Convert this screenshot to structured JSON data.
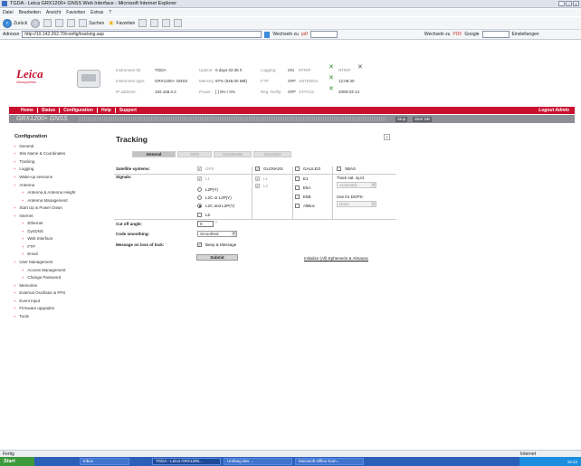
{
  "window": {
    "title": "TGDA - Leica GRX1200+ GNSS Web Interface - Microsoft Internet Explorer",
    "controls": [
      "_",
      "□",
      "X"
    ]
  },
  "menu": [
    "Datei",
    "Bearbeiten",
    "Ansicht",
    "Favoriten",
    "Extras",
    "?"
  ],
  "toolbar": {
    "back": "Zurück",
    "search": "Suchen",
    "favorites": "Favoriten",
    "links": "Links"
  },
  "addressbar": {
    "label": "Adresse",
    "url": "http://10.142.262.70/config/tracking.asp",
    "wechseln": "Wechseln zu",
    "pdf": "pdf",
    "google": "Google",
    "settings": "Einstellungen",
    "pdf2": "PDF"
  },
  "header": {
    "logo_text": "Leica",
    "logo_sub": "Geosystems",
    "info": [
      {
        "label": "Instrument ID:",
        "value": "TGDA",
        "label2": "Uptime:",
        "value2": "0 days 02:35 h",
        "label3": "Logging:",
        "value3": "ON",
        "label4": "NTRIP"
      },
      {
        "label": "Instrument type:",
        "value": "GRX1200+ GNSS",
        "label2": "Memory:",
        "value2": "97% (948.00 MB)",
        "label3": "FTP:",
        "value3": "OFF",
        "label4": "ANTENNA"
      },
      {
        "label": "IP address:",
        "value": "192.168.0.2",
        "label2": "Power:",
        "value2": "[ ] 0% / 0%",
        "label3": "Reg. Notify:",
        "value3": "OFF",
        "label4": "STATUS",
        "time": "12:06:30",
        "date": "2009-03-13"
      }
    ]
  },
  "nav": {
    "items": [
      "Home",
      "Status",
      "Configuration",
      "Help",
      "Support"
    ],
    "admin": "Logout Admin"
  },
  "subbar": {
    "model": "GRX1200+ GNSS",
    "btn1": "Stop",
    "btn2": "Start DB"
  },
  "sidebar": {
    "title": "Configuration",
    "items": [
      {
        "label": "General",
        "indent": 0
      },
      {
        "label": "Site Name & Coordinates",
        "indent": 0
      },
      {
        "label": "Tracking",
        "indent": 0
      },
      {
        "label": "Logging",
        "indent": 0
      },
      {
        "label": "Wake-up sessions",
        "indent": 0
      },
      {
        "label": "Antenna",
        "indent": 0
      },
      {
        "label": "Antenna & Antenna Height",
        "indent": 1
      },
      {
        "label": "Antenna Management",
        "indent": 1
      },
      {
        "label": "Start Up & Power Down",
        "indent": 0
      },
      {
        "label": "Internet",
        "indent": 0
      },
      {
        "label": "Ethernet",
        "indent": 1
      },
      {
        "label": "DynDNS",
        "indent": 1
      },
      {
        "label": "Web Interface",
        "indent": 1
      },
      {
        "label": "FTP",
        "indent": 1
      },
      {
        "label": "Email",
        "indent": 1
      },
      {
        "label": "User Management",
        "indent": 0
      },
      {
        "label": "Access Management",
        "indent": 1
      },
      {
        "label": "Change Password",
        "indent": 1
      },
      {
        "label": "Memories",
        "indent": 0
      },
      {
        "label": "External Oscillator & PPS",
        "indent": 0
      },
      {
        "label": "Event Input",
        "indent": 0
      },
      {
        "label": "Firmware upgrades",
        "indent": 0
      },
      {
        "label": "Tools",
        "indent": 0
      }
    ]
  },
  "content": {
    "title": "Tracking",
    "close": "X",
    "tabs": [
      {
        "label": "General",
        "active": true
      },
      {
        "label": "GPS",
        "active": false
      },
      {
        "label": "GLONASS",
        "active": false
      },
      {
        "label": "GALILEO",
        "active": false
      }
    ],
    "labels": {
      "satellites": "Satellite systems:",
      "signals": "Signals:",
      "cutoff": "Cut off angle:",
      "smoothing": "Code smoothing:",
      "loss": "Message on loss of lock:"
    },
    "systems": [
      {
        "label": "GPS",
        "checked": true,
        "disabled": true
      },
      {
        "label": "GLONASS",
        "checked": true,
        "disabled": false
      },
      {
        "label": "GALILEO",
        "checked": false,
        "disabled": false
      },
      {
        "label": "SBAS",
        "checked": false,
        "disabled": false
      }
    ],
    "gps_signals": [
      {
        "label": "L1",
        "type": "cb",
        "checked": true,
        "disabled": true
      },
      {
        "label": "L2P(Y)",
        "type": "rb",
        "on": false
      },
      {
        "label": "L2C or L2P(Y)",
        "type": "rb",
        "on": false
      },
      {
        "label": "L2C and L2P(Y)",
        "type": "rb",
        "on": true
      },
      {
        "label": "L5",
        "type": "cb",
        "checked": false,
        "disabled": false
      }
    ],
    "glonass_signals": [
      {
        "label": "L1",
        "checked": true,
        "disabled": true
      },
      {
        "label": "L2",
        "checked": true,
        "disabled": true
      }
    ],
    "galileo_signals": [
      {
        "label": "E1",
        "checked": false
      },
      {
        "label": "E5A",
        "checked": false
      },
      {
        "label": "E5B",
        "checked": false
      },
      {
        "label": "AltBoc",
        "checked": false
      }
    ],
    "sbas": {
      "track_label": "Track sat. sy.id.",
      "track_value": "Automatic",
      "use_label": "Use for DGPS:",
      "use_value": "None"
    },
    "cutoff_value": "0",
    "cutoff_unit": "°",
    "smoothing_value": "Smoothed",
    "beep_label": "Beep & Message",
    "submit": "Submit",
    "init_link": "Initialize (All) Ephemeris & Almanac"
  },
  "status": {
    "left": "Fertig",
    "zone": "Internet"
  },
  "taskbar": {
    "start": "Start",
    "tasks": [
      "Inbox",
      "TGDA - Leica GRX1200...",
      "Umfang des ...",
      "Microsoft Office Kom..."
    ],
    "clock": "16:22"
  }
}
